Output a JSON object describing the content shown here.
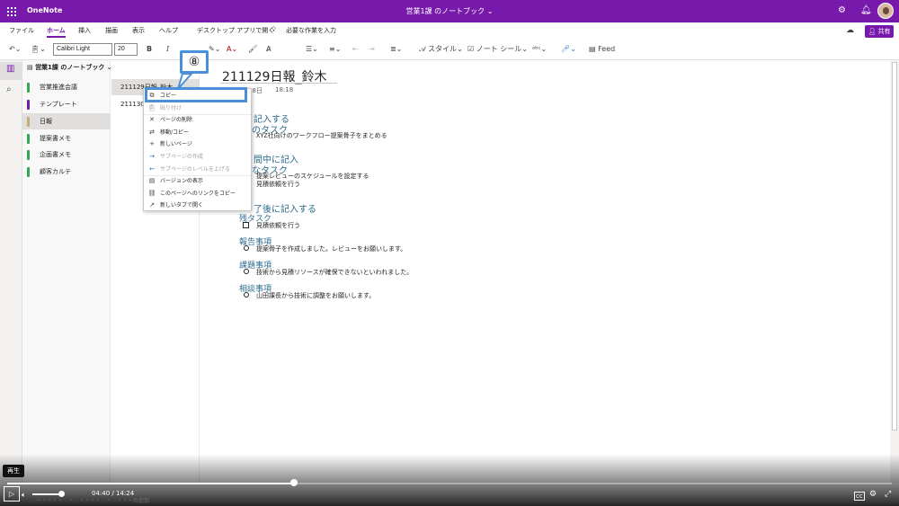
{
  "titlebar": {
    "app_name": "OneNote",
    "document_title": "営業1課 のノートブック ⌄"
  },
  "tabs": [
    "ファイル",
    "ホーム",
    "挿入",
    "描画",
    "表示",
    "ヘルプ"
  ],
  "desktop_open": "デスクトップ アプリで開く",
  "search_hint": "必要な作業を入力",
  "share_label": "共有",
  "ribbon": {
    "font_name": "Calibri Light",
    "font_size": "20",
    "bold": "B",
    "italic": "I",
    "styles_label": "スタイル",
    "note_tags_label": "ノート シール",
    "feed_label": "Feed"
  },
  "notebook_name": "営業1課 のノートブック",
  "sections": [
    {
      "label": "営業推進会議",
      "color": "#33a852"
    },
    {
      "label": "テンプレート",
      "color": "#7719aa"
    },
    {
      "label": "日報",
      "color": "#c8a978"
    },
    {
      "label": "提案書メモ",
      "color": "#33a852"
    },
    {
      "label": "企画書メモ",
      "color": "#33a852"
    },
    {
      "label": "顧客カルテ",
      "color": "#33a852"
    }
  ],
  "pages": [
    "211129日報_鈴木",
    "211130日"
  ],
  "page": {
    "title": "211129日報_鈴木",
    "date": "28日",
    "time": "18:18",
    "heading1": "記入する",
    "heading1_sub": "日のタスク",
    "task1": "XYZ社向けのワークフロー提案骨子をまとめる",
    "heading2": "間中に記入",
    "heading2_sub": "たなタスク",
    "task2": "提案レビューのスケジュールを設定する",
    "task3": "見積依頼を行う",
    "heading3": "了後に記入する",
    "remaining_heading": "残タスク",
    "remaining_item": "見積依頼を行う",
    "report_heading": "報告事項",
    "report_item": "提案骨子を作成しました。レビューをお願いします。",
    "issue_heading": "課題事項",
    "issue_item": "技術から見積リソースが確保できないといわれました。",
    "consult_heading": "相談事項",
    "consult_item": "山田課長から技術に調整をお願いします。"
  },
  "context_menu": [
    {
      "label": "コピー",
      "icon": "copy-icon",
      "disabled": false
    },
    {
      "label": "貼り付け",
      "icon": "paste-icon",
      "disabled": true
    },
    {
      "label": "ページの削除",
      "icon": "delete-icon",
      "disabled": false
    },
    {
      "label": "移動/コピー",
      "icon": "move-icon",
      "disabled": false
    },
    {
      "label": "新しいページ",
      "icon": "plus-icon",
      "disabled": false
    },
    {
      "label": "サブページの作成",
      "icon": "arrow-right-icon",
      "disabled": true
    },
    {
      "label": "サブページのレベルを上げる",
      "icon": "arrow-left-icon",
      "disabled": true
    },
    {
      "label": "バージョンの表示",
      "icon": "versions-icon",
      "disabled": false
    },
    {
      "label": "このページへのリンクをコピー",
      "icon": "link-icon",
      "disabled": false
    },
    {
      "label": "新しいタブで開く",
      "icon": "new-tab-icon",
      "disabled": false
    }
  ],
  "callout_number": "⑧",
  "video": {
    "tooltip": "再生",
    "current_time": "04:40",
    "separator": "/",
    "duration": "14:24",
    "progress": 0.324
  },
  "colors": {
    "accent": "#7719aa",
    "highlight": "#4a90d9",
    "heading": "#2e6c8e"
  }
}
